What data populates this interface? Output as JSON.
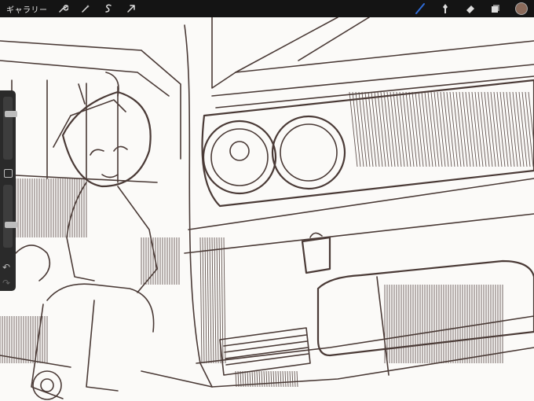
{
  "toolbar": {
    "gallery_label": "ギャラリー",
    "left_tools": [
      "wrench-icon",
      "magic-wand-icon",
      "selection-icon",
      "transform-icon"
    ],
    "right_tools": [
      "brush-icon",
      "smudge-icon",
      "eraser-icon",
      "layers-icon"
    ],
    "active_tool": "brush-icon",
    "brush_color": "#2e6bd6",
    "current_color": "#8a6a5a"
  },
  "sidebar": {
    "size_level": 0.75,
    "opacity_level": 0.35,
    "undo_symbol": "↶",
    "redo_symbol": "↷"
  },
  "canvas": {
    "ink_color": "#4a3a36",
    "paper_color": "#fbfaf8"
  }
}
